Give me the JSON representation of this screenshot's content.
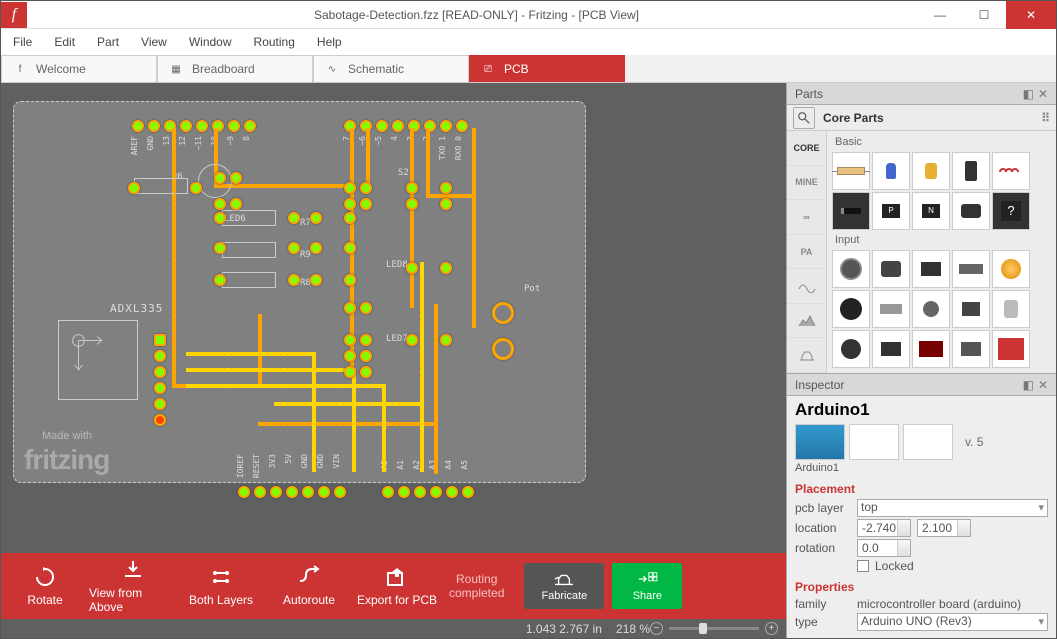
{
  "window": {
    "title": "Sabotage-Detection.fzz [READ-ONLY]  - Fritzing - [PCB View]",
    "app_glyph": "f"
  },
  "menu": [
    "File",
    "Edit",
    "Part",
    "View",
    "Window",
    "Routing",
    "Help"
  ],
  "view_tabs": {
    "welcome": "Welcome",
    "breadboard": "Breadboard",
    "schematic": "Schematic",
    "pcb": "PCB"
  },
  "board": {
    "made_with": "Made with",
    "logo": "fritzing",
    "labels": {
      "adxl": "ADXL335",
      "r6": "R6",
      "r7": "R7",
      "r8": "R8",
      "r9": "R9",
      "led6": "LED6",
      "led7": "LED7",
      "led8": "LED8",
      "s2": "S2",
      "pot": "Pot",
      "top_pins_left": [
        "AREF",
        "GND",
        "13",
        "12",
        "~11",
        "~10",
        "~9",
        "8"
      ],
      "top_pins_right": [
        "7",
        "~6",
        "~5",
        "4",
        "~3",
        "2",
        "TX0 1",
        "RX0 0"
      ],
      "bot_pins_left": [
        "IOREF",
        "RESET",
        "3V3",
        "5V",
        "GND",
        "GND",
        "VIN"
      ],
      "bot_pins_right": [
        "A0",
        "A1",
        "A2",
        "A3",
        "A4",
        "A5"
      ]
    }
  },
  "toolbar": {
    "rotate": "Rotate",
    "view_from": "View from Above",
    "both_layers": "Both Layers",
    "autoroute": "Autoroute",
    "export": "Export for PCB",
    "routing_status_l1": "Routing",
    "routing_status_l2": "completed",
    "fabricate": "Fabricate",
    "share": "Share"
  },
  "status": {
    "coords": "1.043 2.767 in",
    "zoom": "218 %"
  },
  "parts_panel": {
    "title": "Parts",
    "bin_title": "Core Parts",
    "bins": [
      "CORE",
      "MINE",
      "∞",
      "PA",
      " ",
      " ",
      " "
    ],
    "group_basic": "Basic",
    "group_input": "Input"
  },
  "inspector": {
    "title": "Inspector",
    "part_name": "Arduino1",
    "version": "v. 5",
    "subname": "Arduino1",
    "sec_placement": "Placement",
    "lbl_layer": "pcb layer",
    "val_layer": "top",
    "lbl_location": "location",
    "loc_x": "-2.740",
    "loc_y": "2.100",
    "lbl_rotation": "rotation",
    "val_rotation": "0.0",
    "lbl_locked": "Locked",
    "sec_properties": "Properties",
    "lbl_family": "family",
    "val_family": "microcontroller board (arduino)",
    "lbl_type": "type",
    "val_type": "Arduino UNO (Rev3)"
  }
}
